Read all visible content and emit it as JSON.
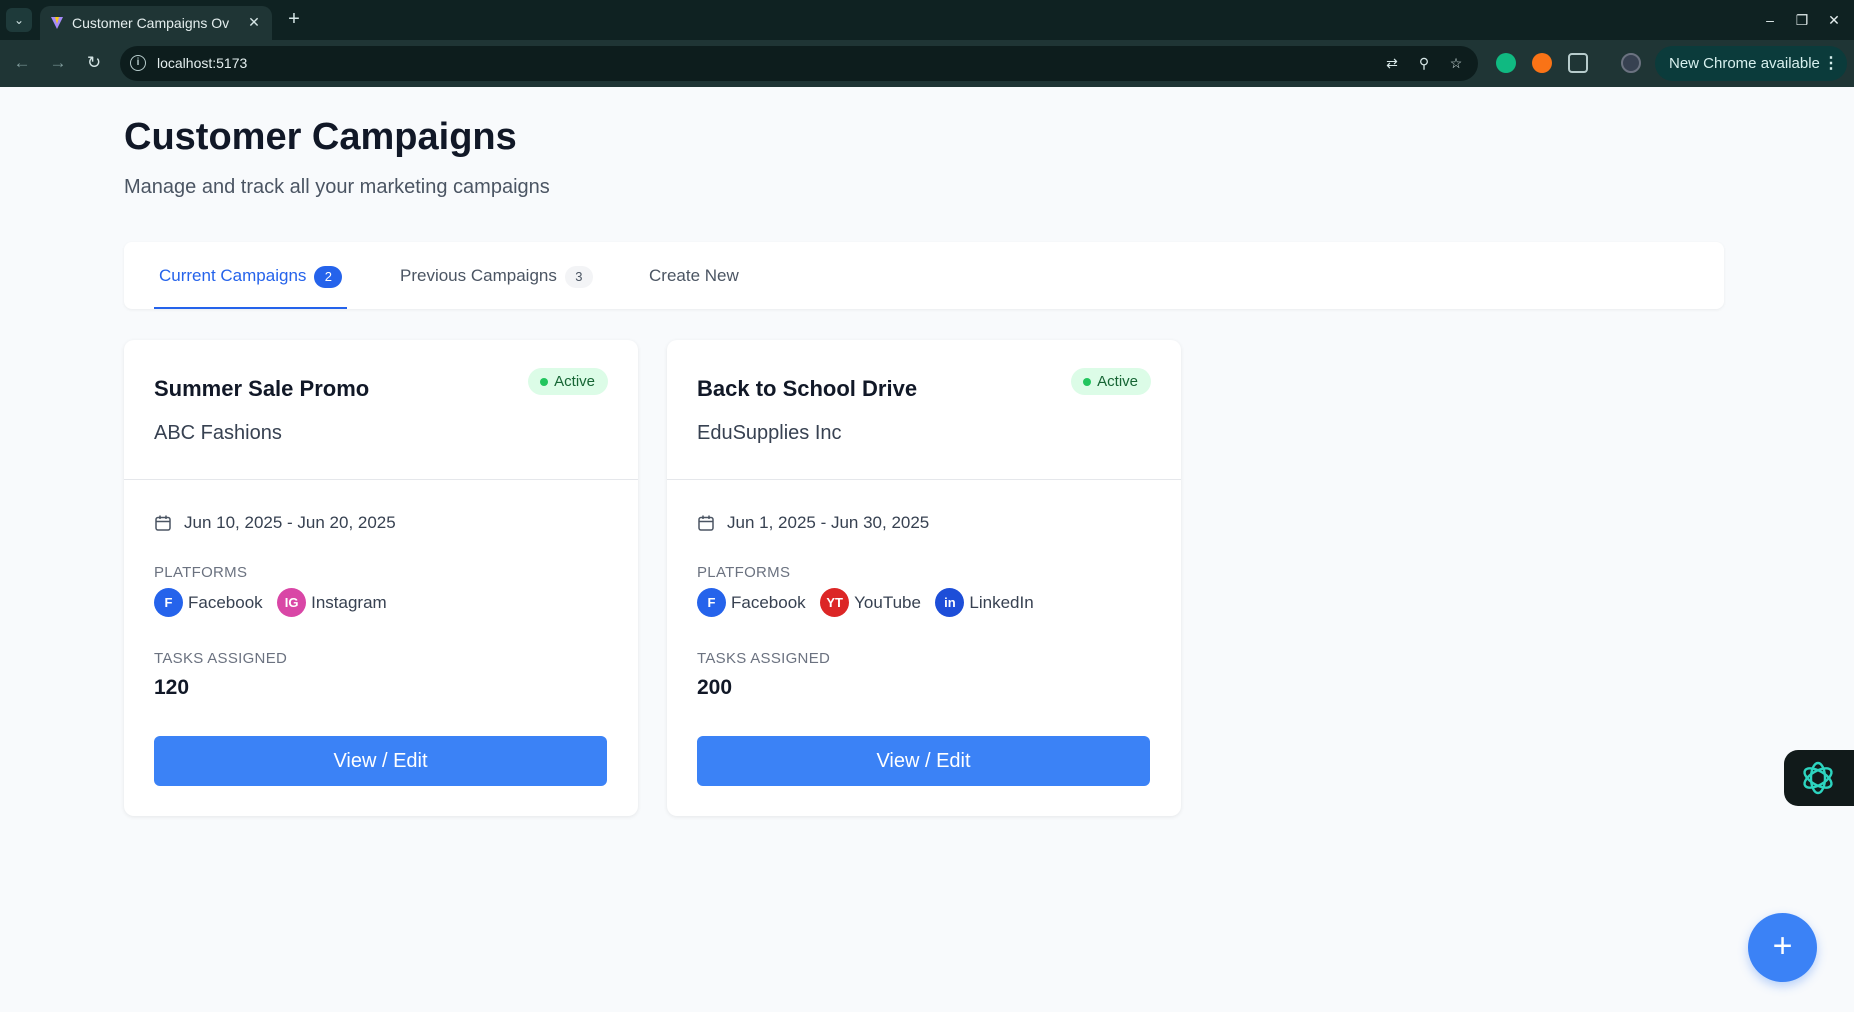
{
  "browser": {
    "tab_title": "Customer Campaigns Ov",
    "tab_close": "✕",
    "new_tab": "+",
    "url": "localhost:5173",
    "update_label": "New Chrome available",
    "menu_dots": "⋮"
  },
  "page": {
    "title": "Customer Campaigns",
    "subtitle": "Manage and track all your marketing campaigns"
  },
  "tabs": [
    {
      "label": "Current Campaigns",
      "count": "2",
      "active": true
    },
    {
      "label": "Previous Campaigns",
      "count": "3",
      "active": false
    },
    {
      "label": "Create New",
      "active": false
    }
  ],
  "labels": {
    "platforms": "PLATFORMS",
    "tasks_assigned": "TASKS ASSIGNED",
    "view_edit": "View / Edit"
  },
  "campaigns": [
    {
      "title": "Summer Sale Promo",
      "client": "ABC Fashions",
      "status": "Active",
      "dates": "Jun 10, 2025 - Jun 20, 2025",
      "platforms": [
        {
          "badge": "F",
          "name": "Facebook",
          "color": "#2563eb"
        },
        {
          "badge": "IG",
          "name": "Instagram",
          "color": "#d946a6"
        }
      ],
      "tasks": "120"
    },
    {
      "title": "Back to School Drive",
      "client": "EduSupplies Inc",
      "status": "Active",
      "dates": "Jun 1, 2025 - Jun 30, 2025",
      "platforms": [
        {
          "badge": "F",
          "name": "Facebook",
          "color": "#2563eb"
        },
        {
          "badge": "YT",
          "name": "YouTube",
          "color": "#dc2626"
        },
        {
          "badge": "in",
          "name": "LinkedIn",
          "color": "#1d4ed8"
        }
      ],
      "tasks": "200"
    }
  ],
  "fab_label": "+",
  "colors": {
    "accent": "#3b82f6",
    "active_tab": "#2563eb",
    "status_bg": "#dcfce7",
    "status_dot": "#22c55e"
  }
}
